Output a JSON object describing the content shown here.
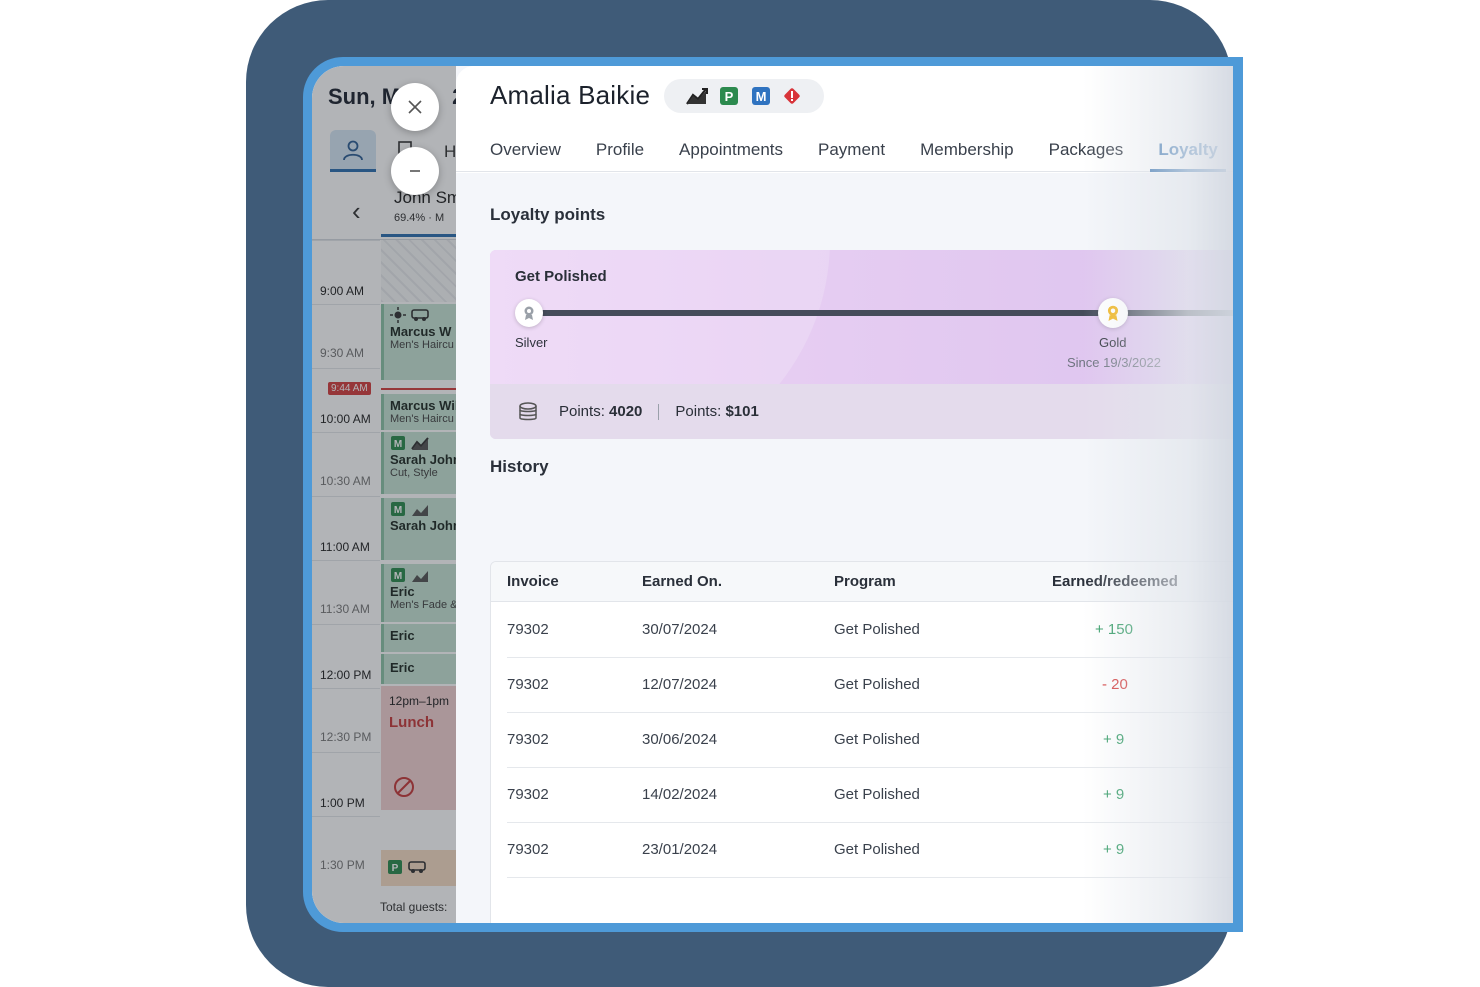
{
  "calendar": {
    "date": "Sun, M",
    "date_suffix": "2",
    "tab_h": "H",
    "staff_name": "John Sm",
    "staff_sub": "69.4%  ·  M",
    "now_badge": "9:44 AM",
    "total_guests": "Total guests:",
    "times": [
      "9:00 AM",
      "9:30 AM",
      "10:00 AM",
      "10:30 AM",
      "11:00 AM",
      "11:30 AM",
      "12:00 PM",
      "12:30 PM",
      "1:00 PM",
      "1:30 PM"
    ],
    "appointments": [
      {
        "name": "Marcus W",
        "service": "Men's Haircu"
      },
      {
        "name": "Marcus Wils",
        "service": "Men's Haircu"
      },
      {
        "name": "Sarah Johns",
        "service": "Cut, Style"
      },
      {
        "name": "Sarah Johns",
        "service": ""
      },
      {
        "name": "Eric",
        "service": "Men's Fade &"
      },
      {
        "name": "Eric",
        "service": ""
      },
      {
        "name": "Eric",
        "service": ""
      }
    ],
    "lunch": {
      "time": "12pm–1pm",
      "label": "Lunch"
    }
  },
  "panel": {
    "client_name": "Amalia Baikie",
    "tags": [
      "trend-icon",
      "p-badge-icon",
      "m-badge-icon",
      "alert-icon"
    ],
    "tabs": [
      "Overview",
      "Profile",
      "Appointments",
      "Payment",
      "Membership",
      "Packages",
      "Loyalty"
    ],
    "active_tab": "Loyalty",
    "loyalty_title": "Loyalty points",
    "program": {
      "name": "Get Polished",
      "tiers": [
        {
          "name": "Silver",
          "since": ""
        },
        {
          "name": "Gold",
          "since": "Since 19/3/2022"
        }
      ],
      "points_label": "Points:",
      "points_value": "4020",
      "points_money_label": "Points:",
      "points_money_value": "$101"
    },
    "history_title": "History",
    "history": {
      "columns": [
        "Invoice",
        "Earned On.",
        "Program",
        "Earned/redeemed"
      ],
      "rows": [
        {
          "invoice": "79302",
          "date": "30/07/2024",
          "program": "Get Polished",
          "amount": "+ 150",
          "sign": "pos"
        },
        {
          "invoice": "79302",
          "date": "12/07/2024",
          "program": "Get Polished",
          "amount": "- 20",
          "sign": "neg"
        },
        {
          "invoice": "79302",
          "date": "30/06/2024",
          "program": "Get Polished",
          "amount": "+ 9",
          "sign": "pos"
        },
        {
          "invoice": "79302",
          "date": "14/02/2024",
          "program": "Get Polished",
          "amount": "+ 9",
          "sign": "pos"
        },
        {
          "invoice": "79302",
          "date": "23/01/2024",
          "program": "Get Polished",
          "amount": "+ 9",
          "sign": "pos"
        }
      ]
    }
  },
  "colors": {
    "frame": "#3f5b78",
    "bezel": "#4e9ad8",
    "accent": "#2566a8",
    "positive": "#2f9a62",
    "negative": "#d43a3a",
    "loyalty_card": "#e6cdf2"
  }
}
